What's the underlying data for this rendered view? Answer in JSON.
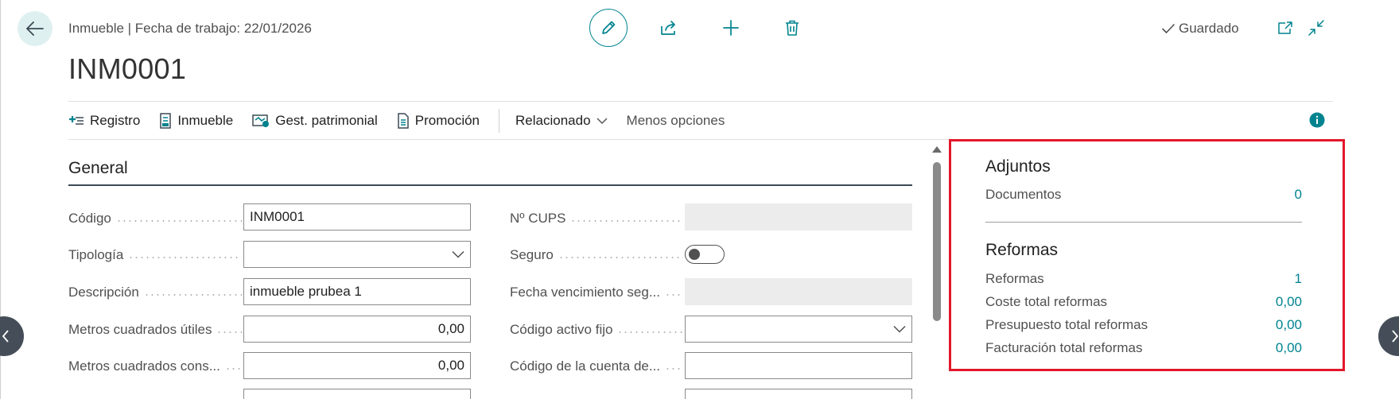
{
  "header": {
    "breadcrumb": "Inmueble | Fecha de trabajo: 22/01/2026",
    "title": "INM0001",
    "status": "Guardado"
  },
  "actions": [
    {
      "label": "Registro",
      "icon": "add-record-icon"
    },
    {
      "label": "Inmueble",
      "icon": "document-icon"
    },
    {
      "label": "Gest. patrimonial",
      "icon": "asset-management-icon"
    },
    {
      "label": "Promoción",
      "icon": "document-list-icon"
    }
  ],
  "related_label": "Relacionado",
  "less_options_label": "Menos opciones",
  "general": {
    "title": "General",
    "left": [
      {
        "label": "Código",
        "value": "INM0001",
        "type": "text"
      },
      {
        "label": "Tipología",
        "value": "",
        "type": "select"
      },
      {
        "label": "Descripción",
        "value": "inmueble prubea 1",
        "type": "text"
      },
      {
        "label": "Metros cuadrados útiles",
        "value": "0,00",
        "type": "number"
      },
      {
        "label": "Metros cuadrados cons...",
        "value": "0,00",
        "type": "number"
      }
    ],
    "right": [
      {
        "label": "Nº CUPS",
        "value": "",
        "type": "disabled"
      },
      {
        "label": "Seguro",
        "value": "",
        "type": "toggle"
      },
      {
        "label": "Fecha vencimiento seg...",
        "value": "",
        "type": "disabled"
      },
      {
        "label": "Código activo fijo",
        "value": "",
        "type": "select"
      },
      {
        "label": "Código de la cuenta de...",
        "value": "",
        "type": "text"
      }
    ]
  },
  "factbox": {
    "adjuntos": {
      "title": "Adjuntos",
      "rows": [
        {
          "label": "Documentos",
          "value": "0"
        }
      ]
    },
    "reformas": {
      "title": "Reformas",
      "rows": [
        {
          "label": "Reformas",
          "value": "1"
        },
        {
          "label": "Coste total reformas",
          "value": "0,00"
        },
        {
          "label": "Presupuesto total reformas",
          "value": "0,00"
        },
        {
          "label": "Facturación total reformas",
          "value": "0,00"
        }
      ]
    }
  },
  "colors": {
    "accent": "#00838f",
    "highlight_border": "#e2162a"
  }
}
